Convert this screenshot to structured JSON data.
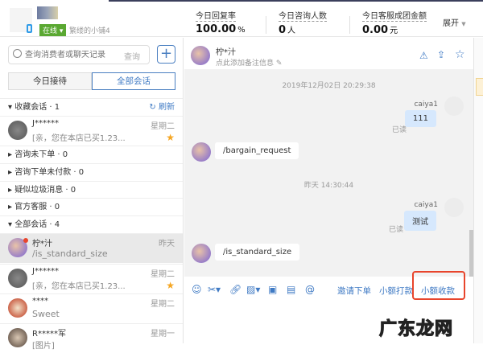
{
  "header": {
    "status_label": "在线",
    "shop_name": "繁缕的小铺4",
    "stats": [
      {
        "label": "今日回复率",
        "value": "100.00",
        "unit": "%"
      },
      {
        "label": "今日咨询人数",
        "value": "0",
        "unit": "人"
      },
      {
        "label": "今日客服成团金额",
        "value": "0.00",
        "unit": "元"
      }
    ],
    "expand_label": "展开"
  },
  "sidebar": {
    "search_placeholder": "查询消费者或聊天记录",
    "search_button": "查询",
    "tabs": [
      "今日接待",
      "全部会话"
    ],
    "favorites": {
      "label": "收藏会话 · 1",
      "refresh": "刷新"
    },
    "groups": [
      "咨询未下单 · 0",
      "咨询下单未付款 · 0",
      "疑似垃圾消息 · 0",
      "官方客服 · 0",
      "全部会话 · 4"
    ],
    "favorite_items": [
      {
        "name": "J******",
        "message": "[亲，您在本店已买1.23...",
        "time": "星期二",
        "starred": true
      }
    ],
    "all_items": [
      {
        "name": "柠*汁",
        "message": "/is_standard_size",
        "time": "昨天",
        "starred": false
      },
      {
        "name": "J******",
        "message": "[亲，您在本店已买1.23...",
        "time": "星期二",
        "starred": true
      },
      {
        "name": "****",
        "message": "Sweet",
        "time": "星期二",
        "starred": false
      },
      {
        "name": "R*****军",
        "message": "[图片]",
        "time": "星期一",
        "starred": false
      }
    ]
  },
  "chat": {
    "name": "柠*汁",
    "note_placeholder": "点此添加备注信息",
    "messages": {
      "ts1": "2019年12月02日 20:29:38",
      "m1_sender": "caiya1",
      "m1_text": "111",
      "m1_read": "已读",
      "m2_text": "/bargain_request",
      "ts2": "昨天 14:30:44",
      "m3_sender": "caiya1",
      "m3_text": "测试",
      "m3_read": "已读",
      "m4_text": "/is_standard_size"
    },
    "actions": [
      "邀请下单",
      "小额打款",
      "小额收款"
    ]
  },
  "watermark": "广东龙网",
  "colors": {
    "accent": "#3f7ac4",
    "online": "#5aa832",
    "highlight": "#e8452c"
  }
}
